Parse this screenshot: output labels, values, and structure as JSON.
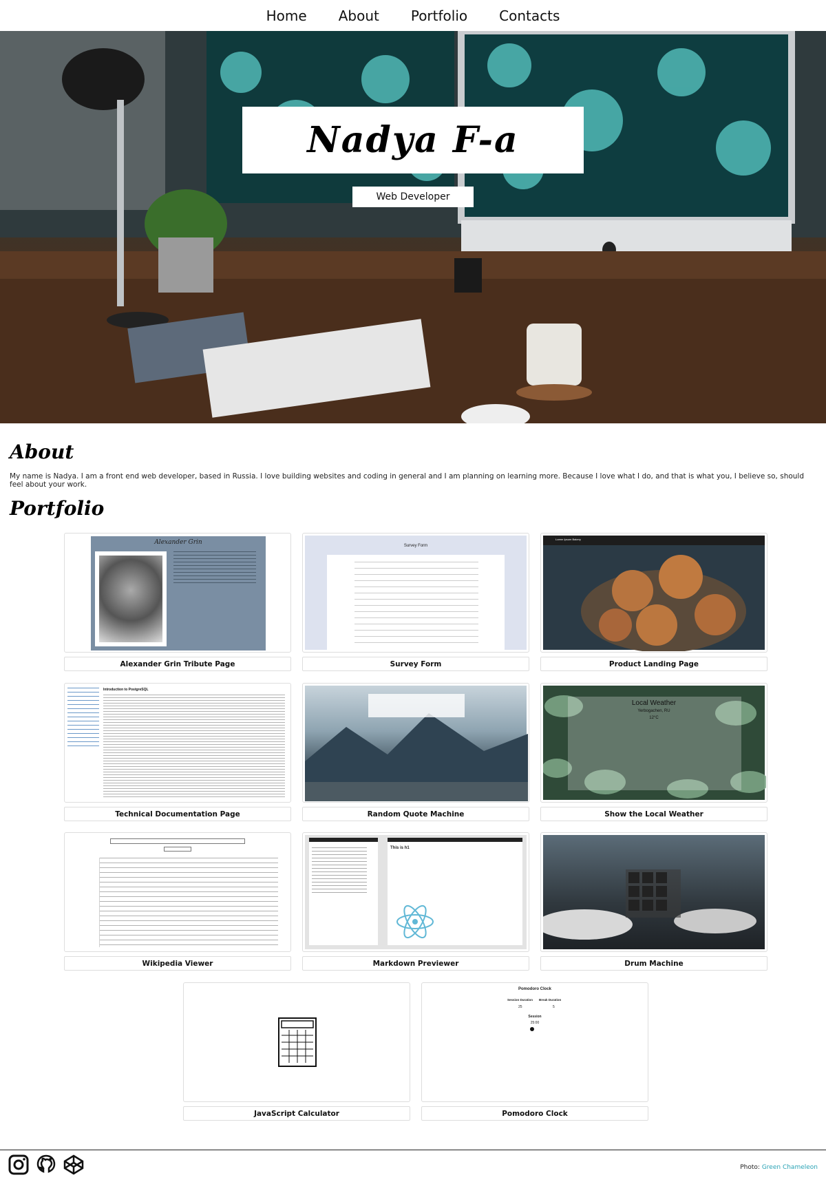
{
  "nav": {
    "items": [
      "Home",
      "About",
      "Portfolio",
      "Contacts"
    ]
  },
  "hero": {
    "name": "Nadya F-a",
    "role": "Web Developer"
  },
  "about": {
    "heading": "About",
    "text": "My name is Nadya. I am a front end web developer, based in Russia. I love building websites and coding in general and I am planning on learning more. Because I love what I do, and that is what you, I believe so, should feel about your work."
  },
  "portfolio": {
    "heading": "Portfolio",
    "projects": [
      {
        "label": "Alexander Grin Tribute Page",
        "thumb_title": "Alexander Grin"
      },
      {
        "label": "Survey Form",
        "thumb_title": "Survey Form"
      },
      {
        "label": "Product Landing Page",
        "thumb_title": "Lorem Ipsum Bakery"
      },
      {
        "label": "Technical Documentation Page",
        "thumb_title": "Introduction to PostgreSQL"
      },
      {
        "label": "Random Quote Machine",
        "thumb_title": ""
      },
      {
        "label": "Show the Local Weather",
        "thumb_title": "Local Weather"
      },
      {
        "label": "Wikipedia Viewer",
        "thumb_title": ""
      },
      {
        "label": "Markdown Previewer",
        "thumb_title": "This is h1"
      },
      {
        "label": "Drum Machine",
        "thumb_title": ""
      },
      {
        "label": "JavaScript Calculator",
        "thumb_title": ""
      },
      {
        "label": "Pomodoro Clock",
        "thumb_title": "Pomodoro Clock"
      }
    ],
    "pomodoro": {
      "session_label": "Session Duration",
      "break_label": "Break Duration",
      "session_value": "25",
      "break_value": "5",
      "mode": "Session",
      "time": "25:00"
    },
    "weather": {
      "city": "Yerbogachen, RU",
      "temp": "12°C"
    }
  },
  "footer": {
    "credit_prefix": "Photo:",
    "credit_link": "Green Chameleon"
  },
  "colors": {
    "accent": "#2aa3b5",
    "text": "#111111",
    "border": "#dddddd"
  }
}
